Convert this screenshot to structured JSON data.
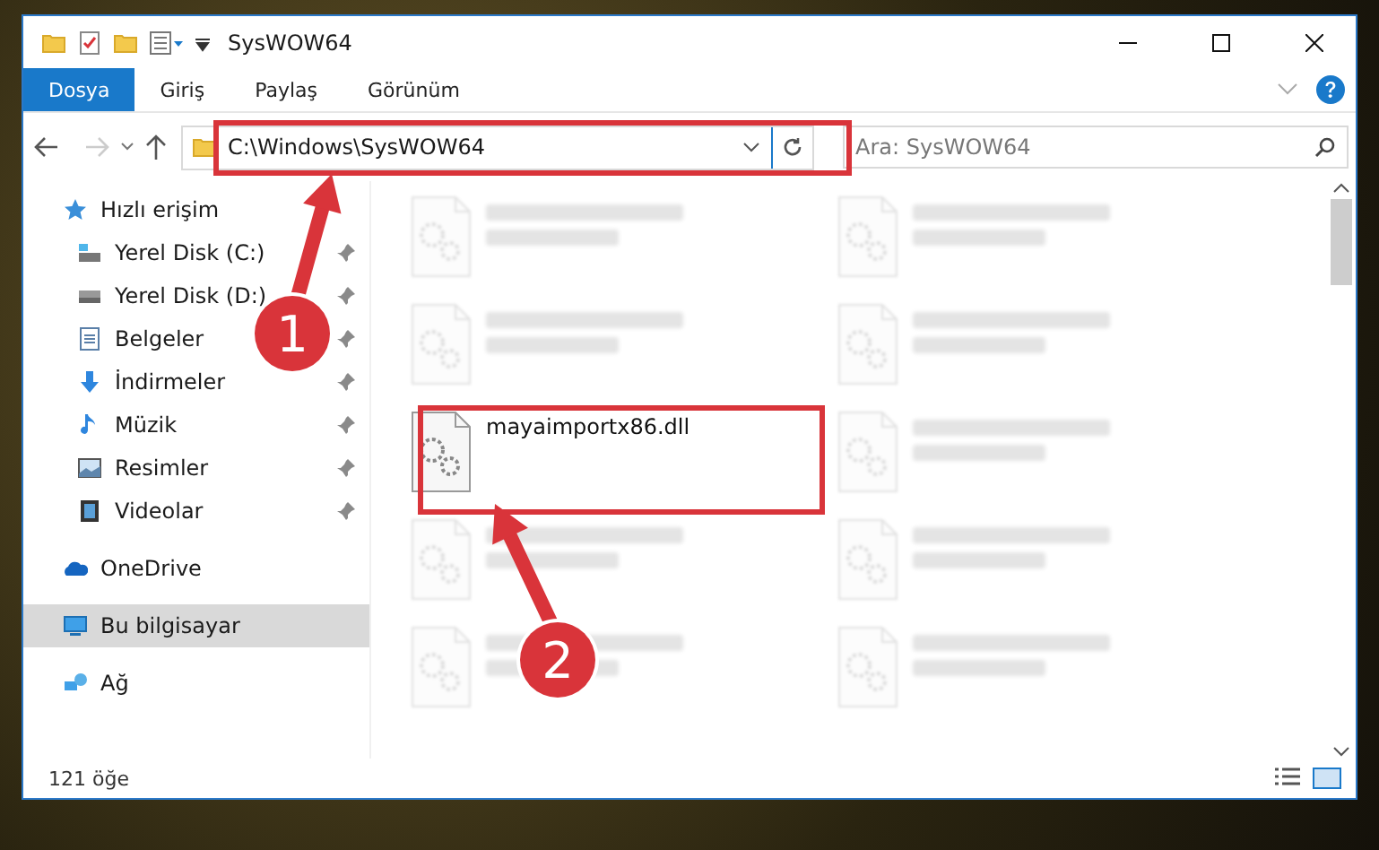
{
  "window": {
    "title": "SysWOW64"
  },
  "ribbon_tabs": [
    {
      "label": "Dosya",
      "selected": true
    },
    {
      "label": "Giriş",
      "selected": false
    },
    {
      "label": "Paylaş",
      "selected": false
    },
    {
      "label": "Görünüm",
      "selected": false
    }
  ],
  "address": {
    "path": "C:\\Windows\\SysWOW64"
  },
  "search": {
    "placeholder": "Ara: SysWOW64"
  },
  "sidebar": {
    "items": [
      {
        "label": "Hızlı erişim",
        "selected": false,
        "children": [
          {
            "label": "Yerel Disk (C:)",
            "pinned": true
          },
          {
            "label": "Yerel Disk (D:)",
            "pinned": true
          },
          {
            "label": "Belgeler",
            "pinned": true
          },
          {
            "label": "İndirmeler",
            "pinned": true
          },
          {
            "label": "Müzik",
            "pinned": true
          },
          {
            "label": "Resimler",
            "pinned": true
          },
          {
            "label": "Videolar",
            "pinned": true
          }
        ]
      },
      {
        "label": "OneDrive",
        "selected": false
      },
      {
        "label": "Bu bilgisayar",
        "selected": true
      },
      {
        "label": "Ağ",
        "selected": false
      }
    ]
  },
  "files": [
    {
      "dimmed": true
    },
    {
      "dimmed": true
    },
    {
      "dimmed": true
    },
    {
      "dimmed": true
    },
    {
      "name": "mayaimportx86.dll",
      "dimmed": false
    },
    {
      "dimmed": true
    },
    {
      "dimmed": true
    },
    {
      "dimmed": true
    },
    {
      "dimmed": true
    },
    {
      "dimmed": true
    }
  ],
  "status_bar": {
    "count": "121 öğe"
  },
  "annotations": [
    {
      "number": "1"
    },
    {
      "number": "2"
    }
  ]
}
